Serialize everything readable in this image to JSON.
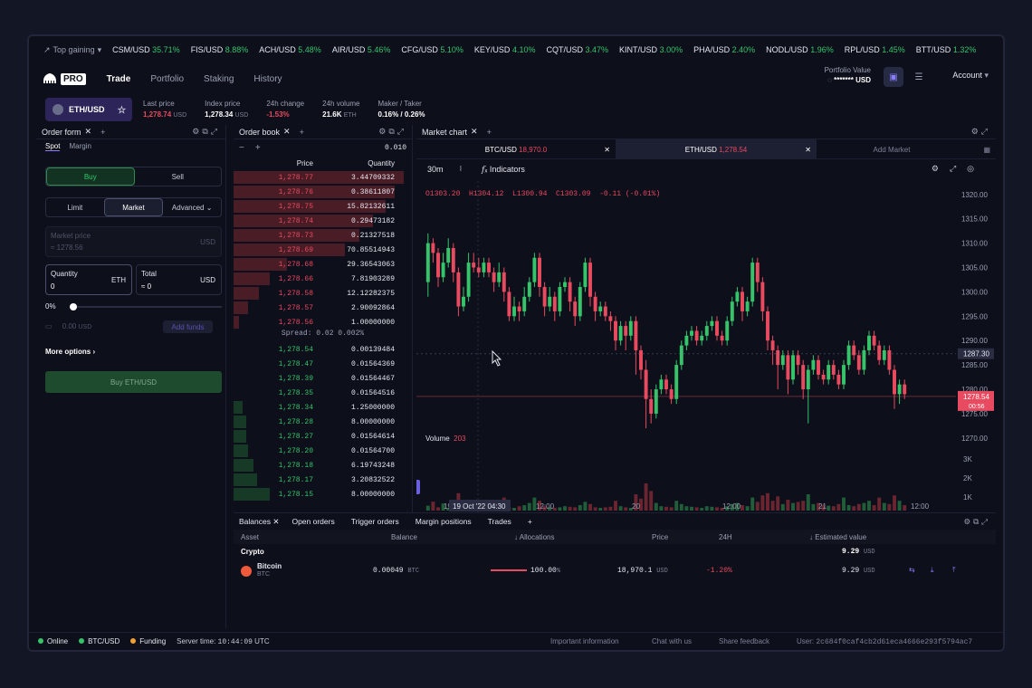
{
  "ticker": {
    "top_label": "Top gaining",
    "items": [
      {
        "pair": "CSM/USD",
        "change": "35.71%"
      },
      {
        "pair": "FIS/USD",
        "change": "8.88%"
      },
      {
        "pair": "ACH/USD",
        "change": "5.48%"
      },
      {
        "pair": "AIR/USD",
        "change": "5.46%"
      },
      {
        "pair": "CFG/USD",
        "change": "5.10%"
      },
      {
        "pair": "KEY/USD",
        "change": "4.10%"
      },
      {
        "pair": "CQT/USD",
        "change": "3.47%"
      },
      {
        "pair": "KINT/USD",
        "change": "3.00%"
      },
      {
        "pair": "PHA/USD",
        "change": "2.40%"
      },
      {
        "pair": "NODL/USD",
        "change": "1.96%"
      },
      {
        "pair": "RPL/USD",
        "change": "1.45%"
      },
      {
        "pair": "BTT/USD",
        "change": "1.32%"
      }
    ]
  },
  "nav": {
    "logo": "PRO",
    "links": [
      "Trade",
      "Portfolio",
      "Staking",
      "History"
    ],
    "portfolio_label": "Portfolio Value",
    "portfolio_value": "******* USD",
    "account": "Account"
  },
  "info": {
    "pair": "ETH/USD",
    "stats": [
      {
        "label": "Last price",
        "value": "1,278.74",
        "unit": "USD",
        "red": true
      },
      {
        "label": "Index price",
        "value": "1,278.34",
        "unit": "USD",
        "red": false
      },
      {
        "label": "24h change",
        "value": "-1.53%",
        "unit": "",
        "red": true
      },
      {
        "label": "24h volume",
        "value": "21.6K",
        "unit": "ETH",
        "red": false
      },
      {
        "label": "Maker / Taker",
        "value": "0.16% / 0.26%",
        "unit": "",
        "red": false
      }
    ]
  },
  "order_form": {
    "title": "Order form",
    "tabs": [
      "Spot",
      "Margin"
    ],
    "buy": "Buy",
    "sell": "Sell",
    "types": [
      "Limit",
      "Market",
      "Advanced"
    ],
    "market_price_label": "Market price",
    "market_price_value": "≈ 1278.56",
    "market_price_unit": "USD",
    "quantity_label": "Quantity",
    "quantity_value": "0",
    "quantity_unit": "ETH",
    "total_label": "Total",
    "total_value": "≈ 0",
    "total_unit": "USD",
    "slider_pct": "0%",
    "funds_value": "0.00",
    "funds_unit": "USD",
    "add_funds": "Add funds",
    "more_options": "More options",
    "submit": "Buy ETH/USD"
  },
  "order_book": {
    "title": "Order book",
    "tick": "0.010",
    "col_price": "Price",
    "col_qty": "Quantity",
    "asks": [
      {
        "p": "1,278.77",
        "q": "3.44709332",
        "d": 0.95
      },
      {
        "p": "1,278.76",
        "q": "0.38611807",
        "d": 0.9
      },
      {
        "p": "1,278.75",
        "q": "15.82132611",
        "d": 0.85
      },
      {
        "p": "1,278.74",
        "q": "0.29473182",
        "d": 0.78
      },
      {
        "p": "1,278.73",
        "q": "0.21327518",
        "d": 0.7
      },
      {
        "p": "1,278.69",
        "q": "70.85514943",
        "d": 0.62
      },
      {
        "p": "1,278.68",
        "q": "29.36543063",
        "d": 0.3
      },
      {
        "p": "1,278.66",
        "q": "7.81903289",
        "d": 0.2
      },
      {
        "p": "1,278.58",
        "q": "12.12282375",
        "d": 0.14
      },
      {
        "p": "1,278.57",
        "q": "2.90092864",
        "d": 0.08
      },
      {
        "p": "1,278.56",
        "q": "1.00000000",
        "d": 0.03
      }
    ],
    "spread": "Spread: 0.02  0.002%",
    "bids": [
      {
        "p": "1,278.54",
        "q": "0.00139484",
        "d": 0.0
      },
      {
        "p": "1,278.47",
        "q": "0.01564369",
        "d": 0.0
      },
      {
        "p": "1,278.39",
        "q": "0.01564467",
        "d": 0.0
      },
      {
        "p": "1,278.35",
        "q": "0.01564516",
        "d": 0.0
      },
      {
        "p": "1,278.34",
        "q": "1.25000000",
        "d": 0.05
      },
      {
        "p": "1,278.28",
        "q": "8.00000000",
        "d": 0.07
      },
      {
        "p": "1,278.27",
        "q": "0.01564614",
        "d": 0.07
      },
      {
        "p": "1,278.20",
        "q": "0.01564700",
        "d": 0.08
      },
      {
        "p": "1,278.18",
        "q": "6.19743248",
        "d": 0.11
      },
      {
        "p": "1,278.17",
        "q": "3.20832522",
        "d": 0.13
      },
      {
        "p": "1,278.15",
        "q": "8.00000000",
        "d": 0.2
      }
    ]
  },
  "chart": {
    "title": "Market chart",
    "tab1_pair": "BTC/USD",
    "tab1_price": "18,970.0",
    "tab2_pair": "ETH/USD",
    "tab2_price": "1,278.54",
    "add_market": "Add Market",
    "interval": "30m",
    "indicators": "Indicators",
    "ohlc_o": "O1303.20",
    "ohlc_h": "H1304.12",
    "ohlc_l": "L1300.94",
    "ohlc_c": "C1303.09",
    "ohlc_chg": "-0.11 (-0.01%)",
    "y_ticks": [
      "1320.00",
      "1315.00",
      "1310.00",
      "1305.00",
      "1300.00",
      "1295.00",
      "1290.00",
      "1285.00",
      "1280.00",
      "1275.00",
      "1270.00"
    ],
    "crosshair_price": "1287.30",
    "last_price": "1278.54",
    "countdown": "00:56",
    "volume_label": "Volume",
    "volume_value": "203",
    "vol_ticks": [
      "3K",
      "2K",
      "1K",
      "0"
    ],
    "x_ticks": [
      "19",
      "12:00",
      "20",
      "12:00",
      "21",
      "12:00"
    ],
    "x_highlight": "19 Oct '22  04:30"
  },
  "chart_data": {
    "type": "candlestick",
    "ylim": [
      1267,
      1322
    ],
    "candles": [
      [
        1302,
        1310,
        1312,
        1299
      ],
      [
        1310,
        1308,
        1311,
        1306
      ],
      [
        1308,
        1303,
        1309,
        1301
      ],
      [
        1303,
        1306,
        1308,
        1302
      ],
      [
        1306,
        1309,
        1311,
        1305
      ],
      [
        1309,
        1304,
        1310,
        1302
      ],
      [
        1304,
        1297,
        1305,
        1295
      ],
      [
        1297,
        1299,
        1301,
        1296
      ],
      [
        1299,
        1306,
        1308,
        1298
      ],
      [
        1306,
        1305,
        1308,
        1304
      ],
      [
        1305,
        1304,
        1307,
        1303
      ],
      [
        1304,
        1306,
        1307,
        1303
      ],
      [
        1306,
        1304,
        1307,
        1303
      ],
      [
        1304,
        1302,
        1305,
        1300
      ],
      [
        1302,
        1304,
        1306,
        1301
      ],
      [
        1304,
        1300,
        1305,
        1298
      ],
      [
        1300,
        1295,
        1301,
        1294
      ],
      [
        1295,
        1297,
        1299,
        1294
      ],
      [
        1297,
        1296,
        1298,
        1294
      ],
      [
        1296,
        1299,
        1301,
        1295
      ],
      [
        1299,
        1302,
        1303,
        1298
      ],
      [
        1302,
        1307,
        1308,
        1301
      ],
      [
        1307,
        1301,
        1308,
        1299
      ],
      [
        1301,
        1297,
        1302,
        1295
      ],
      [
        1297,
        1299,
        1301,
        1296
      ],
      [
        1299,
        1296,
        1300,
        1294
      ],
      [
        1296,
        1301,
        1302,
        1295
      ],
      [
        1301,
        1302,
        1303,
        1300
      ],
      [
        1302,
        1298,
        1303,
        1296
      ],
      [
        1298,
        1295,
        1299,
        1293
      ],
      [
        1295,
        1301,
        1302,
        1294
      ],
      [
        1301,
        1306,
        1307,
        1300
      ],
      [
        1306,
        1299,
        1307,
        1297
      ],
      [
        1299,
        1296,
        1300,
        1294
      ],
      [
        1296,
        1297,
        1298,
        1295
      ],
      [
        1297,
        1295,
        1298,
        1294
      ],
      [
        1295,
        1294,
        1296,
        1292
      ],
      [
        1294,
        1290,
        1295,
        1288
      ],
      [
        1290,
        1293,
        1294,
        1289
      ],
      [
        1293,
        1291,
        1294,
        1288
      ],
      [
        1291,
        1294,
        1295,
        1290
      ],
      [
        1294,
        1288,
        1295,
        1283
      ],
      [
        1288,
        1284,
        1289,
        1282
      ],
      [
        1284,
        1278,
        1286,
        1272
      ],
      [
        1278,
        1275,
        1280,
        1273
      ],
      [
        1275,
        1280,
        1281,
        1274
      ],
      [
        1280,
        1282,
        1283,
        1279
      ],
      [
        1282,
        1280,
        1283,
        1279
      ],
      [
        1280,
        1278,
        1281,
        1277
      ],
      [
        1278,
        1285,
        1286,
        1277
      ],
      [
        1285,
        1289,
        1290,
        1284
      ],
      [
        1289,
        1291,
        1292,
        1288
      ],
      [
        1291,
        1292,
        1293,
        1290
      ],
      [
        1292,
        1290,
        1293,
        1289
      ],
      [
        1290,
        1291,
        1292,
        1289
      ],
      [
        1291,
        1293,
        1294,
        1290
      ],
      [
        1293,
        1294,
        1295,
        1292
      ],
      [
        1294,
        1291,
        1295,
        1290
      ],
      [
        1291,
        1290,
        1292,
        1289
      ],
      [
        1290,
        1294,
        1295,
        1289
      ],
      [
        1294,
        1298,
        1299,
        1293
      ],
      [
        1298,
        1300,
        1301,
        1297
      ],
      [
        1300,
        1296,
        1301,
        1294
      ],
      [
        1296,
        1298,
        1299,
        1295
      ],
      [
        1298,
        1306,
        1307,
        1297
      ],
      [
        1306,
        1302,
        1307,
        1300
      ],
      [
        1302,
        1296,
        1303,
        1294
      ],
      [
        1296,
        1290,
        1297,
        1288
      ],
      [
        1290,
        1288,
        1291,
        1285
      ],
      [
        1288,
        1285,
        1289,
        1280
      ],
      [
        1285,
        1287,
        1288,
        1284
      ],
      [
        1287,
        1282,
        1288,
        1279
      ],
      [
        1282,
        1287,
        1288,
        1281
      ],
      [
        1287,
        1285,
        1288,
        1283
      ],
      [
        1285,
        1280,
        1286,
        1278
      ],
      [
        1280,
        1284,
        1285,
        1273
      ],
      [
        1284,
        1286,
        1287,
        1283
      ],
      [
        1286,
        1283,
        1287,
        1282
      ],
      [
        1283,
        1282,
        1284,
        1281
      ],
      [
        1282,
        1285,
        1286,
        1281
      ],
      [
        1285,
        1283,
        1286,
        1282
      ],
      [
        1283,
        1281,
        1284,
        1280
      ],
      [
        1281,
        1285,
        1286,
        1280
      ],
      [
        1285,
        1289,
        1290,
        1284
      ],
      [
        1289,
        1287,
        1290,
        1286
      ],
      [
        1287,
        1284,
        1288,
        1283
      ],
      [
        1284,
        1288,
        1289,
        1283
      ],
      [
        1288,
        1291,
        1292,
        1287
      ],
      [
        1291,
        1289,
        1292,
        1288
      ],
      [
        1289,
        1286,
        1290,
        1285
      ],
      [
        1286,
        1288,
        1289,
        1285
      ],
      [
        1288,
        1284,
        1289,
        1283
      ],
      [
        1284,
        1279,
        1285,
        1276
      ],
      [
        1279,
        1281,
        1282,
        1277
      ],
      [
        1281,
        1279,
        1282,
        1278
      ]
    ],
    "volume": [
      450,
      820,
      300,
      650,
      250,
      900,
      1600,
      500,
      300,
      280,
      250,
      200,
      350,
      400,
      600,
      1200,
      300,
      250,
      400,
      500,
      700,
      1200,
      900,
      400,
      300,
      250,
      300,
      400,
      350,
      300,
      500,
      800,
      600,
      300,
      250,
      300,
      350,
      900,
      400,
      300,
      250,
      1500,
      1100,
      2500,
      1800,
      700,
      400,
      350,
      300,
      900,
      600,
      400,
      350,
      300,
      250,
      400,
      350,
      300,
      250,
      400,
      600,
      700,
      500,
      400,
      1200,
      800,
      1400,
      1600,
      900,
      1300,
      600,
      1000,
      700,
      800,
      900,
      1500,
      600,
      700,
      500,
      450,
      400,
      600,
      1200,
      500,
      400,
      600,
      700,
      900,
      500,
      1200,
      700,
      600,
      1400,
      900,
      500
    ]
  },
  "bottom": {
    "tabs": [
      "Balances",
      "Open orders",
      "Trigger orders",
      "Margin positions",
      "Trades"
    ],
    "cols": [
      "Asset",
      "Balance",
      "Allocations",
      "Price",
      "24H",
      "Estimated value"
    ],
    "group": "Crypto",
    "group_value": "9.29",
    "group_unit": "USD",
    "row": {
      "name": "Bitcoin",
      "sym": "BTC",
      "balance": "0.00049",
      "balance_unit": "BTC",
      "alloc": "100.00",
      "alloc_unit": "%",
      "price": "18,970.1",
      "price_unit": "USD",
      "change": "-1.20%",
      "value": "9.29",
      "value_unit": "USD"
    }
  },
  "status": {
    "online": "Online",
    "pair": "BTC/USD",
    "funding": "Funding",
    "server_time_label": "Server time:",
    "server_time": "10:44:09",
    "server_time_unit": "UTC",
    "links": [
      "Important information",
      "Chat with us",
      "Share feedback"
    ],
    "user_label": "User:",
    "user_id": "2c684f0caf4cb2d61eca4666e293f5794ac7"
  },
  "colors": {
    "up": "#35c46a",
    "down": "#e84a5f",
    "accent": "#8c7dff"
  }
}
